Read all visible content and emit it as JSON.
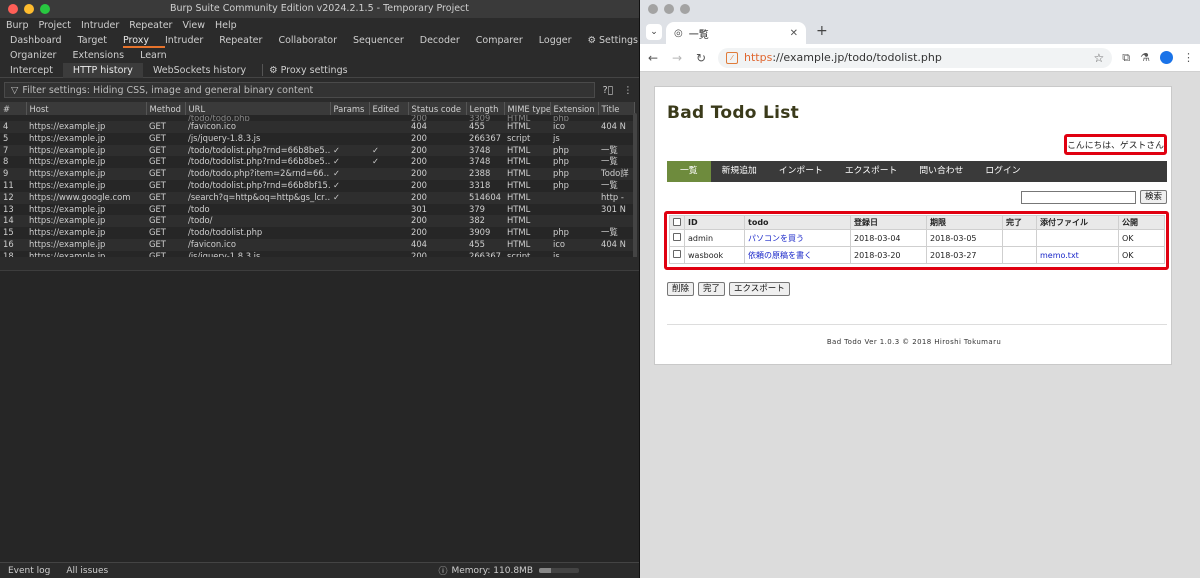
{
  "burp": {
    "window_title": "Burp Suite Community Edition v2024.2.1.5 - Temporary Project",
    "menu": [
      "Burp",
      "Project",
      "Intruder",
      "Repeater",
      "View",
      "Help"
    ],
    "tabs_row1": [
      "Dashboard",
      "Target",
      "Proxy",
      "Intruder",
      "Repeater",
      "Collaborator",
      "Sequencer",
      "Decoder",
      "Comparer",
      "Logger"
    ],
    "settings_label": "Settings",
    "tabs_row2": [
      "Organizer",
      "Extensions",
      "Learn"
    ],
    "subtabs": [
      "Intercept",
      "HTTP history",
      "WebSockets history"
    ],
    "proxy_settings_label": "Proxy settings",
    "filter_text": "Filter settings: Hiding CSS, image and general binary content",
    "columns": [
      "#",
      "Host",
      "Method",
      "URL",
      "Params",
      "Edited",
      "Status code",
      "Length",
      "MIME type",
      "Extension",
      "Title"
    ],
    "partial_row": {
      "num": "",
      "host": "",
      "method": "",
      "url": "/todo/todo.php",
      "params": "",
      "edited": "",
      "status": "200",
      "length": "3309",
      "mime": "HTML",
      "ext": "php",
      "title": ""
    },
    "rows": [
      {
        "num": "4",
        "host": "https://example.jp",
        "method": "GET",
        "url": "/favicon.ico",
        "params": "",
        "edited": "",
        "status": "404",
        "length": "455",
        "mime": "HTML",
        "ext": "ico",
        "title": "404 N"
      },
      {
        "num": "5",
        "host": "https://example.jp",
        "method": "GET",
        "url": "/js/jquery-1.8.3.js",
        "params": "",
        "edited": "",
        "status": "200",
        "length": "266367",
        "mime": "script",
        "ext": "js",
        "title": ""
      },
      {
        "num": "7",
        "host": "https://example.jp",
        "method": "GET",
        "url": "/todo/todolist.php?rnd=66b8be5…",
        "params": "✓",
        "edited": "✓",
        "status": "200",
        "length": "3748",
        "mime": "HTML",
        "ext": "php",
        "title": "一覧"
      },
      {
        "num": "8",
        "host": "https://example.jp",
        "method": "GET",
        "url": "/todo/todolist.php?rnd=66b8be5…",
        "params": "✓",
        "edited": "✓",
        "status": "200",
        "length": "3748",
        "mime": "HTML",
        "ext": "php",
        "title": "一覧"
      },
      {
        "num": "9",
        "host": "https://example.jp",
        "method": "GET",
        "url": "/todo/todo.php?item=2&rnd=66…",
        "params": "✓",
        "edited": "",
        "status": "200",
        "length": "2388",
        "mime": "HTML",
        "ext": "php",
        "title": "Todo詳"
      },
      {
        "num": "11",
        "host": "https://example.jp",
        "method": "GET",
        "url": "/todo/todolist.php?rnd=66b8bf15…",
        "params": "✓",
        "edited": "",
        "status": "200",
        "length": "3318",
        "mime": "HTML",
        "ext": "php",
        "title": "一覧"
      },
      {
        "num": "12",
        "host": "https://www.google.com",
        "method": "GET",
        "url": "/search?q=http&oq=http&gs_lcr…",
        "params": "✓",
        "edited": "",
        "status": "200",
        "length": "514604",
        "mime": "HTML",
        "ext": "",
        "title": "http -"
      },
      {
        "num": "13",
        "host": "https://example.jp",
        "method": "GET",
        "url": "/todo",
        "params": "",
        "edited": "",
        "status": "301",
        "length": "379",
        "mime": "HTML",
        "ext": "",
        "title": "301 N"
      },
      {
        "num": "14",
        "host": "https://example.jp",
        "method": "GET",
        "url": "/todo/",
        "params": "",
        "edited": "",
        "status": "200",
        "length": "382",
        "mime": "HTML",
        "ext": "",
        "title": ""
      },
      {
        "num": "15",
        "host": "https://example.jp",
        "method": "GET",
        "url": "/todo/todolist.php",
        "params": "",
        "edited": "",
        "status": "200",
        "length": "3909",
        "mime": "HTML",
        "ext": "php",
        "title": "一覧"
      },
      {
        "num": "16",
        "host": "https://example.jp",
        "method": "GET",
        "url": "/favicon.ico",
        "params": "",
        "edited": "",
        "status": "404",
        "length": "455",
        "mime": "HTML",
        "ext": "ico",
        "title": "404 N"
      },
      {
        "num": "18",
        "host": "https://example.jp",
        "method": "GET",
        "url": "/js/jquery-1.8.3.js",
        "params": "",
        "edited": "",
        "status": "200",
        "length": "266367",
        "mime": "script",
        "ext": "js",
        "title": ""
      }
    ],
    "status": {
      "event_log": "Event log",
      "all_issues": "All issues",
      "memory": "Memory: 110.8MB",
      "memory_fraction": 0.3
    }
  },
  "browser": {
    "tab_title": "一覧",
    "url_scheme": "https",
    "url_rest": "://example.jp/todo/todolist.php",
    "page": {
      "title": "Bad Todo List",
      "greeting": "こんにちは、ゲストさん",
      "nav": [
        "一覧",
        "新規追加",
        "インポート",
        "エクスポート",
        "問い合わせ",
        "ログイン"
      ],
      "search_button": "検索",
      "columns": [
        "",
        "ID",
        "todo",
        "登録日",
        "期限",
        "完了",
        "添付ファイル",
        "公開"
      ],
      "rows": [
        {
          "id": "admin",
          "todo": "パソコンを買う",
          "created": "2018-03-04",
          "due": "2018-03-05",
          "done": "",
          "attachment": "",
          "public": "OK"
        },
        {
          "id": "wasbook",
          "todo": "依頼の原稿を書く",
          "created": "2018-03-20",
          "due": "2018-03-27",
          "done": "",
          "attachment": "memo.txt",
          "public": "OK"
        }
      ],
      "actions": [
        "削除",
        "完了",
        "エクスポート"
      ],
      "footer": "Bad Todo Ver 1.0.3 © 2018 Hiroshi Tokumaru"
    }
  },
  "colors": {
    "burp_accent": "#e6732c",
    "highlight_red": "#e00010",
    "nav_active": "#6e8b3d",
    "link": "#1a27c9"
  }
}
